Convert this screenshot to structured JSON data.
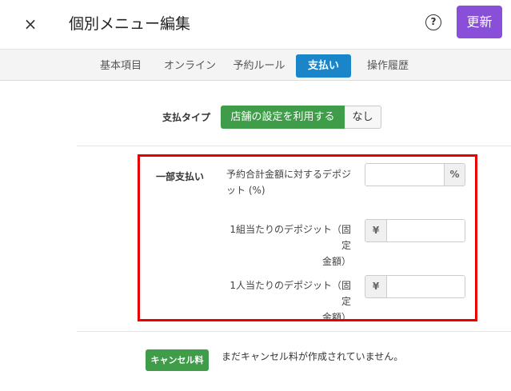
{
  "header": {
    "close_glyph": "×",
    "title": "個別メニュー編集",
    "help_glyph": "?",
    "update_label": "更新",
    "accent_color": "#8a4fd8"
  },
  "tabs": [
    {
      "label": "基本項目",
      "active": false
    },
    {
      "label": "オンライン",
      "active": false
    },
    {
      "label": "予約ルール",
      "active": false
    },
    {
      "label": "支払い",
      "active": true
    },
    {
      "label": "操作履歴",
      "active": false
    }
  ],
  "payment_type": {
    "label": "支払タイプ",
    "options": [
      "店舗の設定を利用する",
      "なし"
    ],
    "selected": "店舗の設定を利用する"
  },
  "partial_payment": {
    "label": "一部支払い",
    "fields": [
      {
        "label_line1": "予約合計金額に対するデポジ",
        "label_line2": "ット (%)",
        "unit": "%",
        "value": ""
      },
      {
        "label_line1": "1組当たりのデポジット（固定",
        "label_line2": "金額）",
        "unit": "¥",
        "value": ""
      },
      {
        "label_line1": "1人当たりのデポジット（固定",
        "label_line2": "金額）",
        "unit": "¥",
        "value": ""
      }
    ]
  },
  "cancellation": {
    "button_label": "キャンセル料",
    "message": "まだキャンセル料が作成されていません。"
  },
  "colors": {
    "tab_active": "#1a85c8",
    "green": "#3f9d4a",
    "highlight": "#e60000"
  }
}
